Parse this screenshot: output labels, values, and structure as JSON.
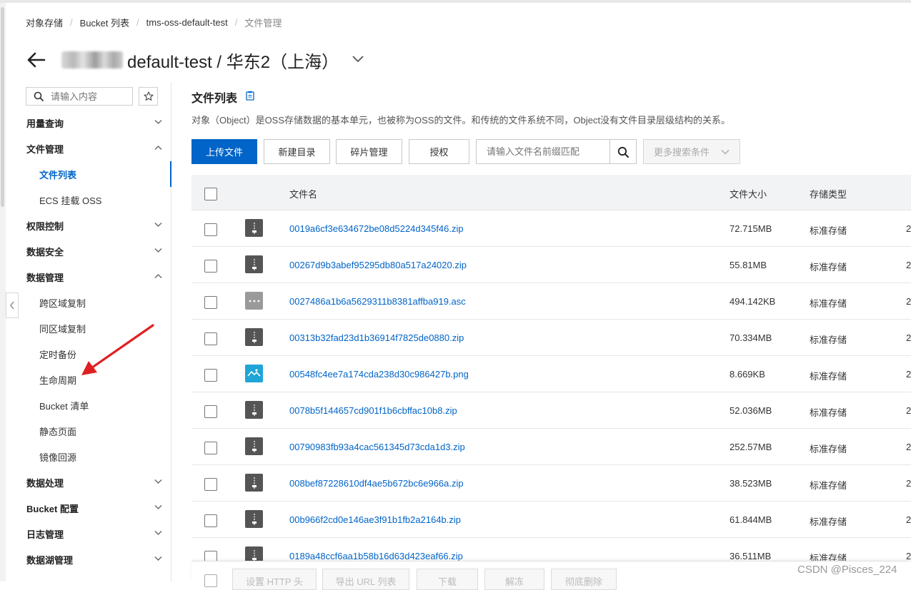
{
  "breadcrumb": {
    "items": [
      "对象存储",
      "Bucket 列表",
      "tms-oss-default-test"
    ],
    "current": "文件管理"
  },
  "header": {
    "title": "default-test / 华东2（上海）"
  },
  "sidebar": {
    "search_placeholder": "请输入内容",
    "items": [
      {
        "label": "用量查询",
        "level": 0,
        "expanded": false
      },
      {
        "label": "文件管理",
        "level": 0,
        "expanded": true
      },
      {
        "label": "文件列表",
        "level": 1,
        "active": true
      },
      {
        "label": "ECS 挂载 OSS",
        "level": 1
      },
      {
        "label": "权限控制",
        "level": 0,
        "expanded": false
      },
      {
        "label": "数据安全",
        "level": 0,
        "expanded": false
      },
      {
        "label": "数据管理",
        "level": 0,
        "expanded": true
      },
      {
        "label": "跨区域复制",
        "level": 1
      },
      {
        "label": "同区域复制",
        "level": 1
      },
      {
        "label": "定时备份",
        "level": 1
      },
      {
        "label": "生命周期",
        "level": 1
      },
      {
        "label": "Bucket 清单",
        "level": 1
      },
      {
        "label": "静态页面",
        "level": 1
      },
      {
        "label": "镜像回源",
        "level": 1
      },
      {
        "label": "数据处理",
        "level": 0,
        "expanded": false
      },
      {
        "label": "Bucket 配置",
        "level": 0,
        "expanded": false
      },
      {
        "label": "日志管理",
        "level": 0,
        "expanded": false
      },
      {
        "label": "数据湖管理",
        "level": 0,
        "expanded": false
      }
    ]
  },
  "main": {
    "title": "文件列表",
    "description": "对象（Object）是OSS存储数据的基本单元，也被称为OSS的文件。和传统的文件系统不同，Object没有文件目录层级结构的关系。",
    "toolbar": {
      "upload": "上传文件",
      "new_dir": "新建目录",
      "fragments": "碎片管理",
      "authorize": "授权",
      "search_placeholder": "请输入文件名前缀匹配",
      "more_search": "更多搜索条件"
    },
    "table": {
      "columns": [
        "文件名",
        "文件大小",
        "存储类型"
      ],
      "rows": [
        {
          "name": "0019a6cf3e634672be08d5224d345f46.zip",
          "size": "72.715MB",
          "type": "标准存储",
          "icon": "zip",
          "date": "2"
        },
        {
          "name": "00267d9b3abef95295db80a517a24020.zip",
          "size": "55.81MB",
          "type": "标准存储",
          "icon": "zip",
          "date": "2"
        },
        {
          "name": "0027486a1b6a5629311b8381affba919.asc",
          "size": "494.142KB",
          "type": "标准存储",
          "icon": "asc",
          "date": "2"
        },
        {
          "name": "00313b32fad23d1b36914f7825de0880.zip",
          "size": "70.334MB",
          "type": "标准存储",
          "icon": "zip",
          "date": "2"
        },
        {
          "name": "00548fc4ee7a174cda238d30c986427b.png",
          "size": "8.669KB",
          "type": "标准存储",
          "icon": "png",
          "date": "2"
        },
        {
          "name": "0078b5f144657cd901f1b6cbffac10b8.zip",
          "size": "52.036MB",
          "type": "标准存储",
          "icon": "zip",
          "date": "2"
        },
        {
          "name": "00790983fb93a4cac561345d73cda1d3.zip",
          "size": "252.57MB",
          "type": "标准存储",
          "icon": "zip",
          "date": "2"
        },
        {
          "name": "008bef87228610df4ae5b672bc6e966a.zip",
          "size": "38.523MB",
          "type": "标准存储",
          "icon": "zip",
          "date": "2"
        },
        {
          "name": "00b966f2cd0e146ae3f91b1fb2a2164b.zip",
          "size": "61.844MB",
          "type": "标准存储",
          "icon": "zip",
          "date": "2"
        },
        {
          "name": "0189a48ccf6aa1b58b16d63d423eaf66.zip",
          "size": "36.511MB",
          "type": "标准存储",
          "icon": "zip",
          "date": "2"
        }
      ]
    },
    "footer": {
      "set_http": "设置 HTTP 头",
      "export_url": "导出 URL 列表",
      "download": "下载",
      "unfreeze": "解冻",
      "delete": "彻底删除"
    }
  },
  "watermark": "CSDN @Pisces_224",
  "colors": {
    "primary": "#0064c8",
    "annotation_arrow": "#e02020"
  }
}
